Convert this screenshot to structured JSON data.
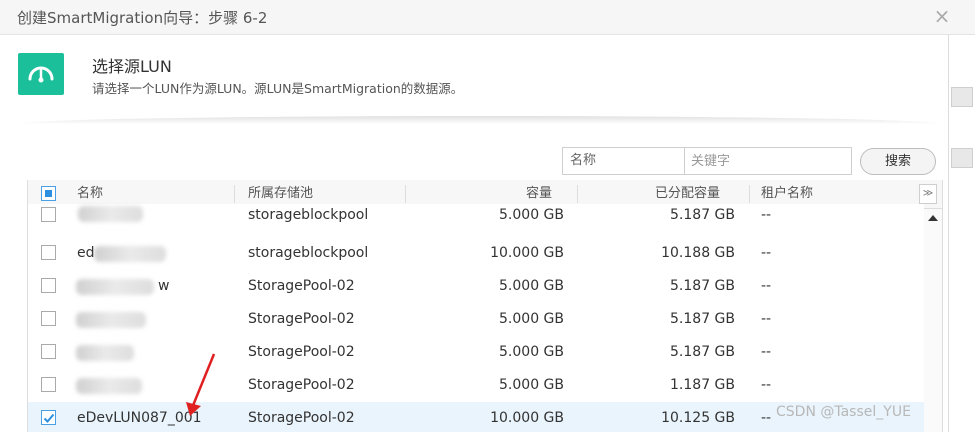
{
  "window": {
    "title": "创建SmartMigration向导：步骤 6-2",
    "close_label": "×"
  },
  "step": {
    "icon": "gauge-icon",
    "accent": "#1bbf9a",
    "title": "选择源LUN",
    "description": "请选择一个LUN作为源LUN。源LUN是SmartMigration的数据源。"
  },
  "search": {
    "field_label": "名称",
    "placeholder": "关键字",
    "button_label": "搜索"
  },
  "table": {
    "columns": [
      "名称",
      "所属存储池",
      "容量",
      "已分配容量",
      "租户名称"
    ],
    "rows": [
      {
        "name": "",
        "pool": "storageblockpool",
        "capacity": "5.000 GB",
        "allocated": "5.187 GB",
        "tenant": "--",
        "checked": false,
        "selected": false
      },
      {
        "name": "ed",
        "pool": "storageblockpool",
        "capacity": "10.000 GB",
        "allocated": "10.188 GB",
        "tenant": "--",
        "checked": false,
        "selected": false
      },
      {
        "name": "w",
        "pool": "StoragePool-02",
        "capacity": "5.000 GB",
        "allocated": "5.187 GB",
        "tenant": "--",
        "checked": false,
        "selected": false
      },
      {
        "name": "",
        "pool": "StoragePool-02",
        "capacity": "5.000 GB",
        "allocated": "5.187 GB",
        "tenant": "--",
        "checked": false,
        "selected": false
      },
      {
        "name": "",
        "pool": "StoragePool-02",
        "capacity": "5.000 GB",
        "allocated": "5.187 GB",
        "tenant": "--",
        "checked": false,
        "selected": false
      },
      {
        "name": "",
        "pool": "StoragePool-02",
        "capacity": "5.000 GB",
        "allocated": "1.187 GB",
        "tenant": "--",
        "checked": false,
        "selected": false
      },
      {
        "name": "eDevLUN087_001",
        "pool": "StoragePool-02",
        "capacity": "10.000 GB",
        "allocated": "10.125 GB",
        "tenant": "--",
        "checked": true,
        "selected": true
      }
    ]
  },
  "watermark": "CSDN @Tassel_YUE",
  "colors": {
    "accent_green": "#1bbf9a",
    "checkbox_blue": "#2d8fe0",
    "selected_row": "#e9f4fc",
    "annotation_red": "#e02020"
  }
}
